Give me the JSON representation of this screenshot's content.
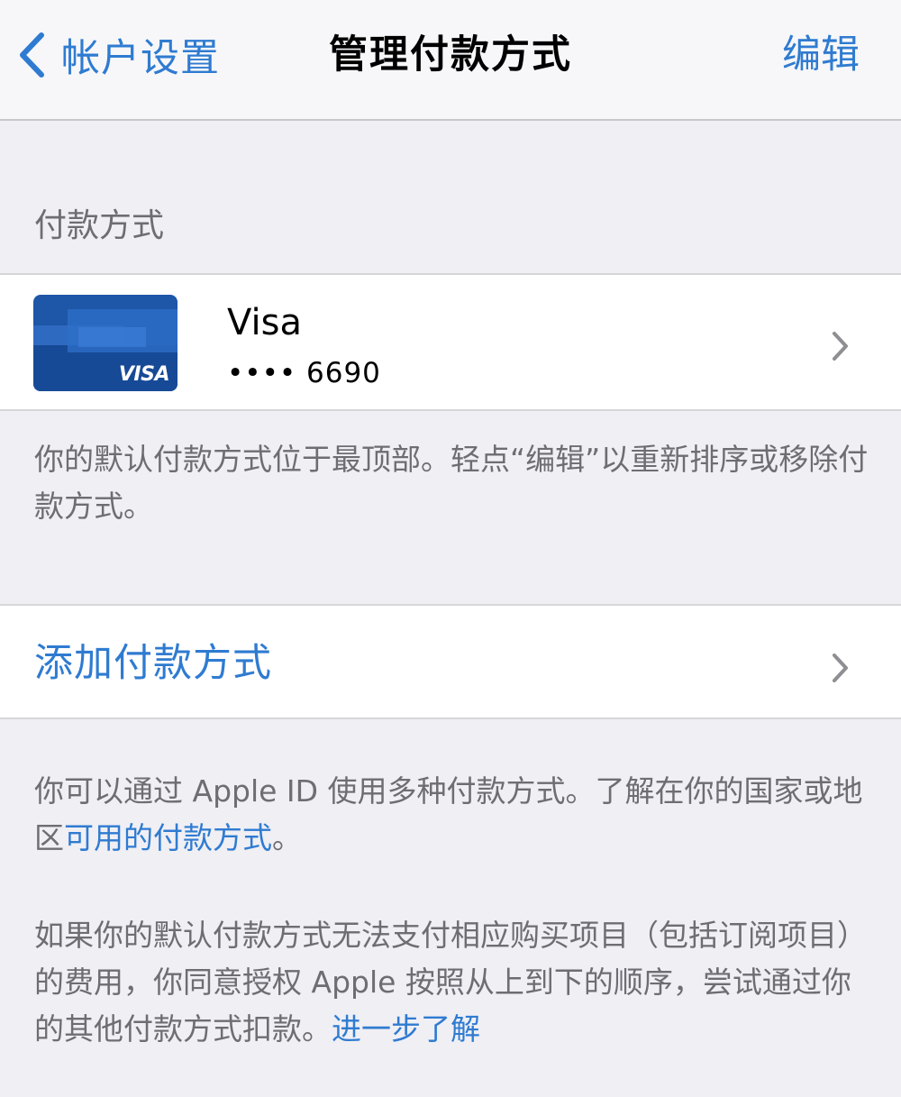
{
  "navbar": {
    "back_label": "帐户设置",
    "title": "管理付款方式",
    "edit_label": "编辑"
  },
  "section": {
    "header": "付款方式"
  },
  "card": {
    "name": "Visa",
    "number": "•••• 6690",
    "brand_mark": "VISA"
  },
  "notes": {
    "default_note": "你的默认付款方式位于最顶部。轻点“编辑”以重新排序或移除付款方式。",
    "apple_id_note_prefix": "你可以通过 Apple ID 使用多种付款方式。了解在你的国家或地区",
    "apple_id_note_link": "可用的付款方式",
    "apple_id_note_suffix": "。",
    "authorize_note": "如果你的默认付款方式无法支付相应购买项目（包括订阅项目）的费用，你同意授权 Apple 按照从上到下的顺序，尝试通过你的其他付款方式扣款。",
    "authorize_link": "进一步了解"
  },
  "add_payment": {
    "label": "添加付款方式"
  },
  "colors": {
    "accent": "#2f7bd1",
    "background": "#efeff4",
    "secondary_text": "#6d6d72",
    "card_blue": "#1e56a8"
  }
}
